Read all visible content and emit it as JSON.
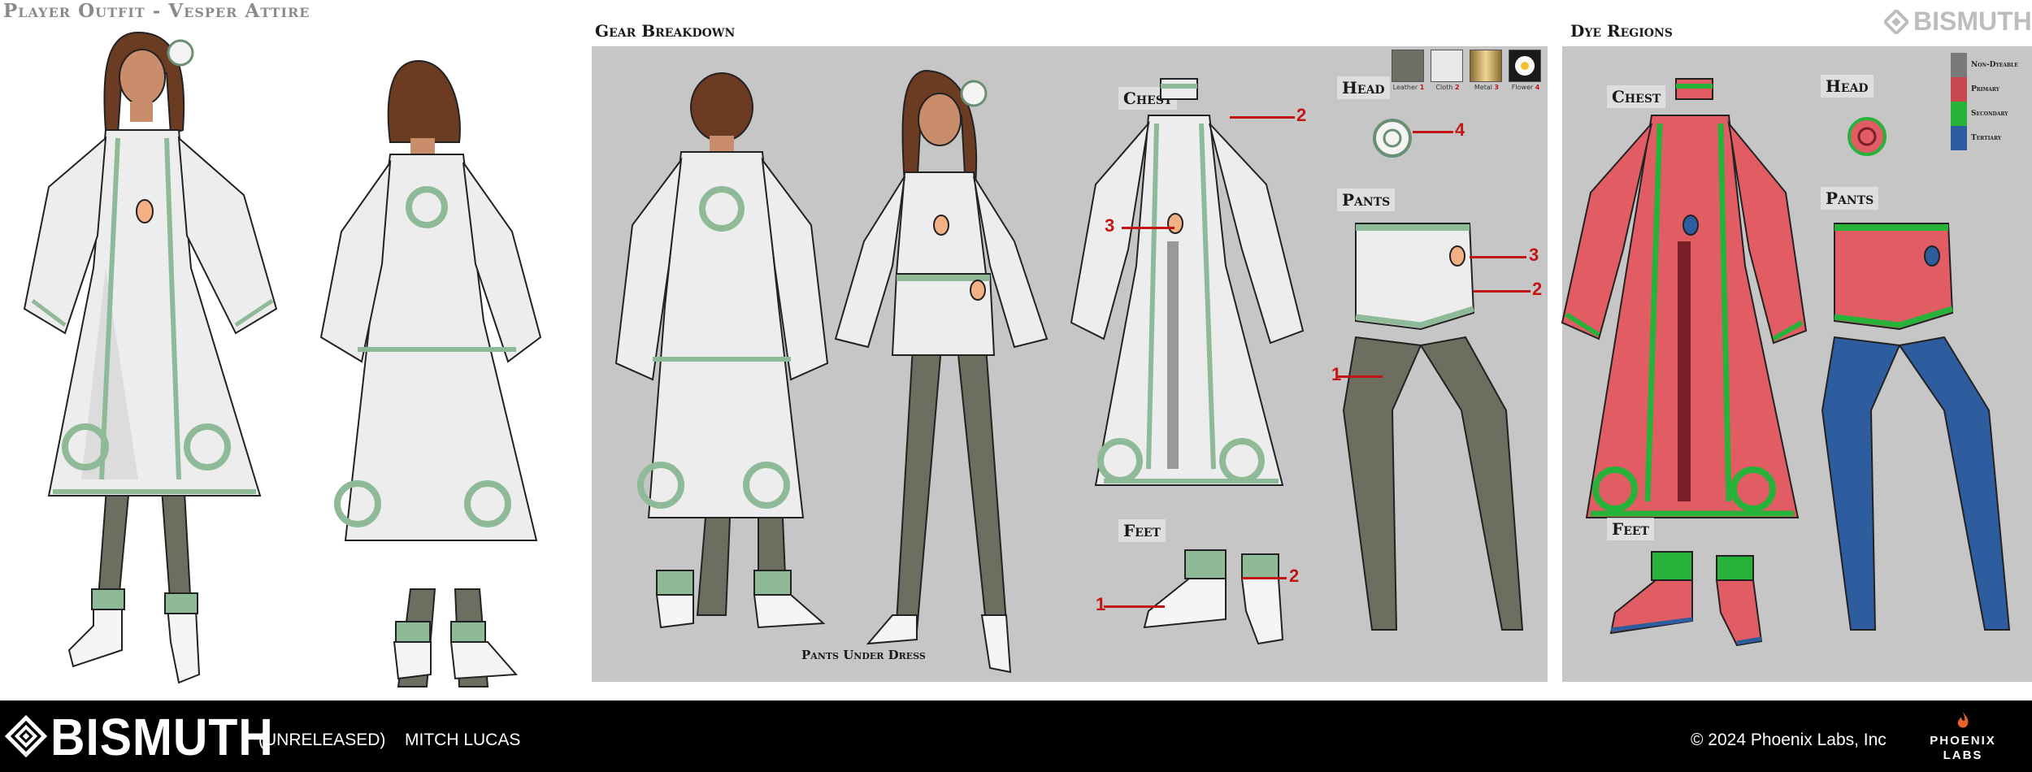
{
  "header": {
    "title": "Player Outfit - Vesper Attire",
    "gear_title": "Gear Breakdown",
    "dye_title": "Dye Regions",
    "brand": "BISMUTH"
  },
  "gear": {
    "labels": {
      "chest": "Chest",
      "head": "Head",
      "pants": "Pants",
      "feet": "Feet"
    },
    "caption": "Pants Under Dress",
    "swatches": [
      {
        "name": "Leather",
        "num": "1",
        "color": "#6f6f66"
      },
      {
        "name": "Cloth",
        "num": "2",
        "color": "#e9e9e9"
      },
      {
        "name": "Metal",
        "num": "3",
        "color": "#c9a45a"
      },
      {
        "name": "Flower",
        "num": "4",
        "color": "#1a1a1a"
      }
    ],
    "callouts": {
      "chest_2": "2",
      "chest_3": "3",
      "head_4": "4",
      "pants_3": "3",
      "pants_2": "2",
      "pants_1": "1",
      "feet_1": "1",
      "feet_2": "2"
    }
  },
  "dye": {
    "labels": {
      "chest": "Chest",
      "head": "Head",
      "pants": "Pants",
      "feet": "Feet"
    },
    "legend": [
      {
        "label": "Non-Dyeable",
        "color": "#7a7a7a"
      },
      {
        "label": "Primary",
        "color": "#c9474e"
      },
      {
        "label": "Secondary",
        "color": "#27b33a"
      },
      {
        "label": "Tertiary",
        "color": "#2e5d9f"
      }
    ]
  },
  "colors": {
    "cloth": "#ededed",
    "trim": "#8fba98",
    "legs": "#6d6d60",
    "hair": "#6b3b22",
    "skin": "#c98d6c",
    "primary": "#e25c63",
    "secondary": "#27b33a",
    "tertiary": "#2e5d9f"
  },
  "footer": {
    "brand": "BISMUTH",
    "status": "(UNRELEASED)",
    "author": "MITCH LUCAS",
    "copyright": "© 2024 Phoenix Labs, Inc",
    "studio_line1": "PHOENIX",
    "studio_line2": "LABS"
  }
}
